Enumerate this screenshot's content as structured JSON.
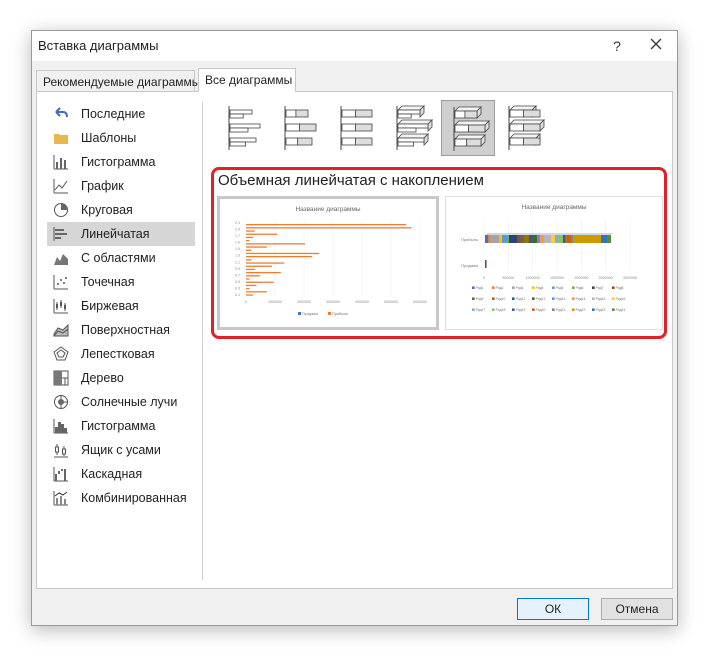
{
  "window": {
    "title": "Вставка диаграммы",
    "help": "?"
  },
  "tabs": [
    {
      "label": "Рекомендуемые диаграммы"
    },
    {
      "label": "Все диаграммы"
    }
  ],
  "sidebar": {
    "items": [
      {
        "label": "Последние",
        "icon": "undo-arrow-icon"
      },
      {
        "label": "Шаблоны",
        "icon": "folder-icon"
      },
      {
        "label": "Гистограмма",
        "icon": "column-chart-icon"
      },
      {
        "label": "График",
        "icon": "line-chart-icon"
      },
      {
        "label": "Круговая",
        "icon": "pie-chart-icon"
      },
      {
        "label": "Линейчатая",
        "icon": "bar-chart-icon",
        "selected": true
      },
      {
        "label": "С областями",
        "icon": "area-chart-icon"
      },
      {
        "label": "Точечная",
        "icon": "scatter-chart-icon"
      },
      {
        "label": "Биржевая",
        "icon": "stock-chart-icon"
      },
      {
        "label": "Поверхностная",
        "icon": "surface-chart-icon"
      },
      {
        "label": "Лепестковая",
        "icon": "radar-chart-icon"
      },
      {
        "label": "Дерево",
        "icon": "treemap-icon"
      },
      {
        "label": "Солнечные лучи",
        "icon": "sunburst-icon"
      },
      {
        "label": "Гистограмма",
        "icon": "histogram-icon"
      },
      {
        "label": "Ящик с усами",
        "icon": "box-whisker-icon"
      },
      {
        "label": "Каскадная",
        "icon": "waterfall-icon"
      },
      {
        "label": "Комбинированная",
        "icon": "combo-chart-icon"
      }
    ]
  },
  "subtypes": {
    "selected_index": 4,
    "selected_title": "Объемная линейчатая с накоплением"
  },
  "previews": [
    {
      "title": "Название диаграммы",
      "legend": [
        "Продажи",
        "Прибыль"
      ],
      "x_ticks": [
        "0",
        "1000000",
        "2000000",
        "3000000",
        "4000000",
        "5000000",
        "6000000"
      ],
      "y_ticks": [
        "2.3",
        "1.9",
        "1.7",
        "1.6",
        "1.5",
        "1.3",
        "1.1",
        "0.9",
        "0.7",
        "0.5",
        "0.3",
        "0.1"
      ]
    },
    {
      "title": "Название диаграммы",
      "y_labels": [
        "Прибыль",
        "Продажи"
      ],
      "x_ticks": [
        "0",
        "500000",
        "1000000",
        "1500000",
        "2000000",
        "2500000",
        "3000000"
      ],
      "legend": [
        "Ряд1",
        "Ряд2",
        "Ряд3",
        "Ряд4",
        "Ряд5",
        "Ряд6",
        "Ряд7",
        "Ряд8",
        "Ряд9",
        "Ряд10",
        "Ряд11",
        "Ряд12",
        "Ряд13",
        "Ряд14",
        "Ряд15",
        "Ряд16",
        "Ряд17",
        "Ряд18",
        "Ряд19",
        "Ряд20",
        "Ряд21",
        "Ряд22",
        "Ряд23",
        "Ряд24"
      ]
    }
  ],
  "buttons": {
    "ok": "ОК",
    "cancel": "Отмена"
  },
  "colors": {
    "accent": "#0078d7",
    "highlight": "#e0202a",
    "series_orange": "#ed7d31",
    "series_blue": "#4472c4"
  }
}
